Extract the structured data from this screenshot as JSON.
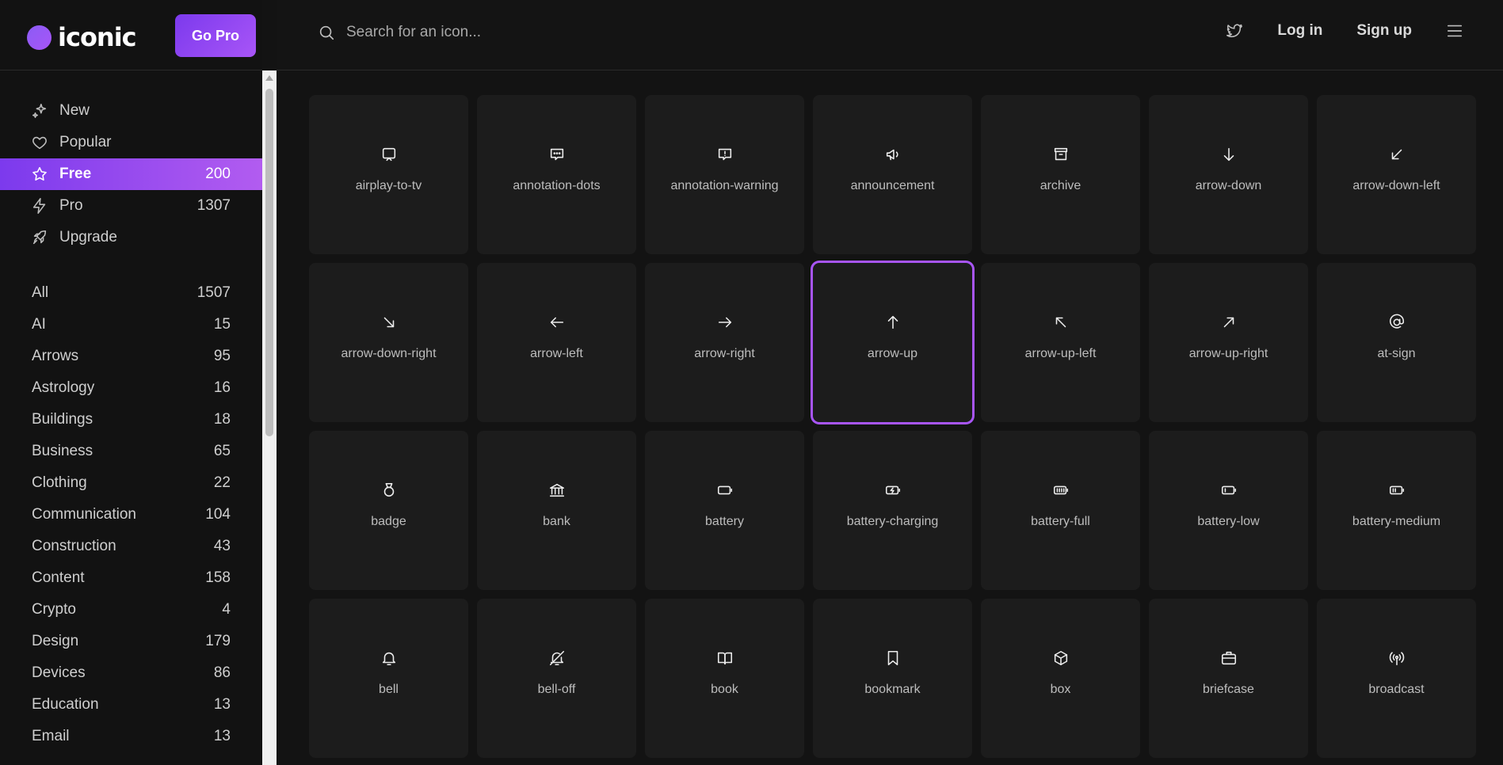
{
  "brand": {
    "name": "iconic",
    "accent": "#a855f7"
  },
  "header": {
    "go_pro": "Go Pro",
    "search_placeholder": "Search for an icon...",
    "login": "Log in",
    "signup": "Sign up"
  },
  "nav": [
    {
      "label": "New",
      "count": "",
      "icon": "sparkle-icon"
    },
    {
      "label": "Popular",
      "count": "",
      "icon": "heart-icon"
    },
    {
      "label": "Free",
      "count": "200",
      "icon": "star-icon",
      "active": true
    },
    {
      "label": "Pro",
      "count": "1307",
      "icon": "bolt-icon"
    },
    {
      "label": "Upgrade",
      "count": "",
      "icon": "rocket-icon"
    }
  ],
  "categories": [
    {
      "label": "All",
      "count": "1507"
    },
    {
      "label": "AI",
      "count": "15"
    },
    {
      "label": "Arrows",
      "count": "95"
    },
    {
      "label": "Astrology",
      "count": "16"
    },
    {
      "label": "Buildings",
      "count": "18"
    },
    {
      "label": "Business",
      "count": "65"
    },
    {
      "label": "Clothing",
      "count": "22"
    },
    {
      "label": "Communication",
      "count": "104"
    },
    {
      "label": "Construction",
      "count": "43"
    },
    {
      "label": "Content",
      "count": "158"
    },
    {
      "label": "Crypto",
      "count": "4"
    },
    {
      "label": "Design",
      "count": "179"
    },
    {
      "label": "Devices",
      "count": "86"
    },
    {
      "label": "Education",
      "count": "13"
    },
    {
      "label": "Email",
      "count": "13"
    }
  ],
  "icons": [
    {
      "name": "airplay-to-tv"
    },
    {
      "name": "annotation-dots"
    },
    {
      "name": "annotation-warning"
    },
    {
      "name": "announcement"
    },
    {
      "name": "archive"
    },
    {
      "name": "arrow-down"
    },
    {
      "name": "arrow-down-left"
    },
    {
      "name": "arrow-down-right"
    },
    {
      "name": "arrow-left"
    },
    {
      "name": "arrow-right"
    },
    {
      "name": "arrow-up",
      "selected": true
    },
    {
      "name": "arrow-up-left"
    },
    {
      "name": "arrow-up-right"
    },
    {
      "name": "at-sign"
    },
    {
      "name": "badge"
    },
    {
      "name": "bank"
    },
    {
      "name": "battery"
    },
    {
      "name": "battery-charging"
    },
    {
      "name": "battery-full"
    },
    {
      "name": "battery-low"
    },
    {
      "name": "battery-medium"
    },
    {
      "name": "bell"
    },
    {
      "name": "bell-off"
    },
    {
      "name": "book"
    },
    {
      "name": "bookmark"
    },
    {
      "name": "box"
    },
    {
      "name": "briefcase"
    },
    {
      "name": "broadcast"
    }
  ]
}
